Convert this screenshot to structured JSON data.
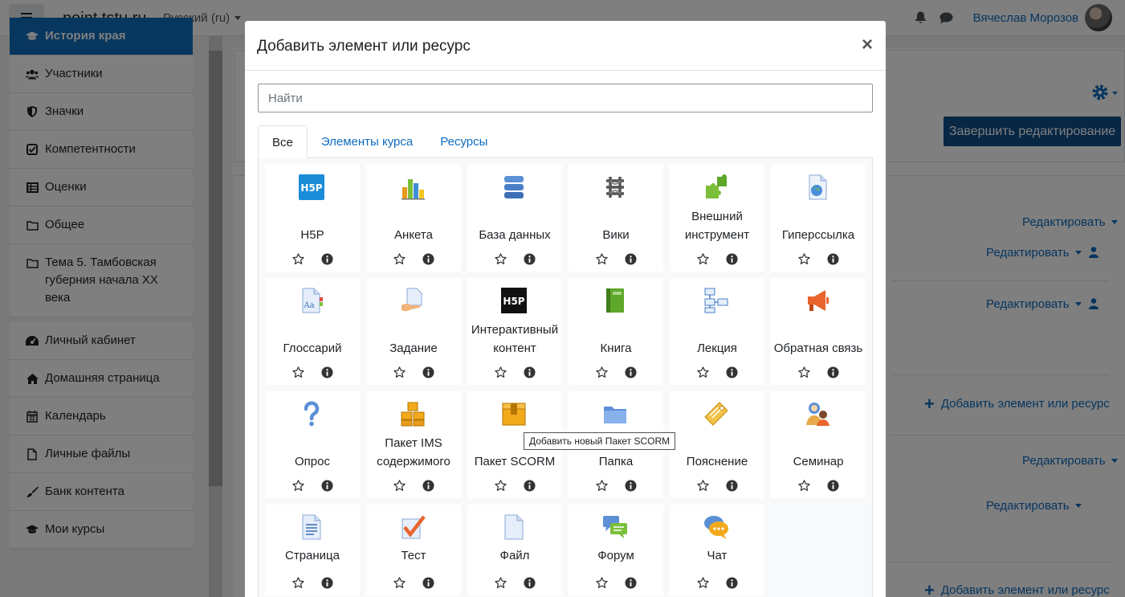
{
  "navbar": {
    "site_name": "point.tstu.ru",
    "language": "Русский (ru)",
    "user_name": "Вячеслав Морозов"
  },
  "drawer": {
    "items": [
      {
        "label": "История края",
        "icon": "graduation-cap-icon",
        "active": true
      },
      {
        "label": "Участники",
        "icon": "users-icon"
      },
      {
        "label": "Значки",
        "icon": "shield-icon"
      },
      {
        "label": "Компетентности",
        "icon": "check-square-icon"
      },
      {
        "label": "Оценки",
        "icon": "table-icon"
      },
      {
        "label": "Общее",
        "icon": "folder-icon"
      },
      {
        "label": "Тема 5. Тамбовская губерния начала XX века",
        "icon": "folder-icon"
      },
      {
        "label": "Личный кабинет",
        "icon": "dashboard-icon"
      },
      {
        "label": "Домашняя страница",
        "icon": "home-icon"
      },
      {
        "label": "Календарь",
        "icon": "calendar-icon"
      },
      {
        "label": "Личные файлы",
        "icon": "file-icon"
      },
      {
        "label": "Банк контента",
        "icon": "paint-brush-icon"
      },
      {
        "label": "Мои курсы",
        "icon": "graduation-cap-icon"
      }
    ]
  },
  "page": {
    "finish_editing": "Завершить редактирование",
    "edit_label": "Редактировать",
    "add_label": "Добавить элемент или ресурс"
  },
  "modal": {
    "title": "Добавить элемент или ресурс",
    "close": "×",
    "search_placeholder": "Найти",
    "tabs": [
      "Все",
      "Элементы курса",
      "Ресурсы"
    ],
    "tooltip": "Добавить новый Пакет SCORM",
    "modules": [
      {
        "name": "H5P",
        "icon": "h5p-icon"
      },
      {
        "name": "Анкета",
        "icon": "chart-icon"
      },
      {
        "name": "База данных",
        "icon": "database-icon"
      },
      {
        "name": "Вики",
        "icon": "wiki-icon"
      },
      {
        "name": "Внешний инструмент",
        "icon": "puzzle-icon"
      },
      {
        "name": "Гиперссылка",
        "icon": "url-icon"
      },
      {
        "name": "Глоссарий",
        "icon": "glossary-icon"
      },
      {
        "name": "Задание",
        "icon": "assignment-icon"
      },
      {
        "name": "Интерактивный контент",
        "icon": "h5p-dark-icon"
      },
      {
        "name": "Книга",
        "icon": "book-icon"
      },
      {
        "name": "Лекция",
        "icon": "lesson-icon"
      },
      {
        "name": "Обратная связь",
        "icon": "megaphone-icon"
      },
      {
        "name": "Опрос",
        "icon": "question-icon"
      },
      {
        "name": "Пакет IMS содержимого",
        "icon": "ims-boxes-icon"
      },
      {
        "name": "Пакет SCORM",
        "icon": "scorm-box-icon"
      },
      {
        "name": "Папка",
        "icon": "folder-blue-icon"
      },
      {
        "name": "Пояснение",
        "icon": "label-tag-icon"
      },
      {
        "name": "Семинар",
        "icon": "workshop-icon"
      },
      {
        "name": "Страница",
        "icon": "page-icon"
      },
      {
        "name": "Тест",
        "icon": "quiz-icon"
      },
      {
        "name": "Файл",
        "icon": "file-resource-icon"
      },
      {
        "name": "Форум",
        "icon": "forum-icon"
      },
      {
        "name": "Чат",
        "icon": "chat-icon"
      }
    ]
  }
}
